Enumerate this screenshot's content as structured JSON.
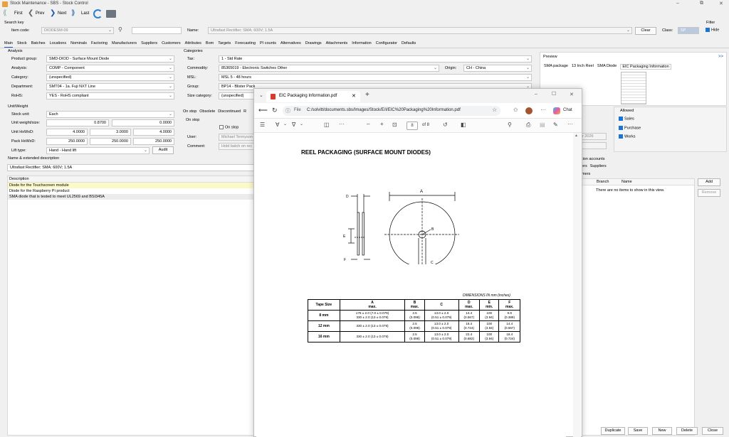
{
  "window": {
    "title": "Stock Maintenance - SBS - Stock Control",
    "min": "–",
    "restore": "⧉",
    "close": "✕"
  },
  "toolbar": {
    "first": "First",
    "prev": "Prev",
    "next": "Next",
    "last": "Last"
  },
  "search": {
    "section": "Search key",
    "item_code_label": "Item code:",
    "item_code": "DIODESM-09",
    "name_label": "Name:",
    "name": "Ultrafast Rectifier; SMA; 600V; 1.5A",
    "clear": "Clear",
    "class_label": "Class:",
    "class_value": "SP",
    "filter_label": "Filter",
    "hide": "Hide"
  },
  "tabs": [
    "Main",
    "Stock",
    "Batches",
    "Locations",
    "Nominals",
    "Factoring",
    "Manufacturers",
    "Suppliers",
    "Customers",
    "Attributes",
    "Bom",
    "Targets",
    "Forecasting",
    "PI counts",
    "Alternatives",
    "Drawings",
    "Attachments",
    "Information",
    "Configurator",
    "Defaults"
  ],
  "analysis": {
    "header": "Analysis",
    "product_group_label": "Product group:",
    "product_group": "SMD-DIOD - Surface Mount Diode",
    "analysis_label": "Analysis:",
    "analysis": "COMP - Component",
    "category_label": "Category:",
    "category": "(unspecified)",
    "department_label": "Department:",
    "department": "SMT04 - 1a. Fuji NXT Line",
    "rohs_label": "RoHS:",
    "rohs": "YES - RoHS compliant"
  },
  "categories": {
    "header": "Categories",
    "tax_label": "Tax:",
    "tax": "1 - Std Rate",
    "commodity_label": "Commodity:",
    "commodity": "85365019 - Electronic Switches Other",
    "origin_label": "Origin:",
    "origin": "CH - China",
    "msl_label": "MSL:",
    "msl": "MSL 5 - 48 hours",
    "group_label": "Group:",
    "group": "BP14 - Blister Pack",
    "size_label": "Size category:",
    "size": "(unspecified)"
  },
  "unit": {
    "header": "Unit/Weight",
    "stock_unit_label": "Stock unit:",
    "stock_unit": "Each",
    "weight_label": "Unit weight/size:",
    "weight": "0.8700",
    "size": "0.0000",
    "hwd_label": "Unit HxWxD:",
    "h": "4.0000",
    "w": "3.0000",
    "d": "4.0000",
    "pack_label": "Pack HxWxD:",
    "ph": "250.0000",
    "pw": "250.0000",
    "pd": "250.0000",
    "lift_label": "Lift type:",
    "lift": "Hand - Hand lift",
    "audit": "Audit"
  },
  "onstop": {
    "tabs": [
      "On stop",
      "Obsolete",
      "Discontinued",
      "R"
    ],
    "header": "On stop",
    "check_label": "On stop",
    "user_label": "User:",
    "user": "Michael Tennyson",
    "comment_label": "Comment:",
    "comment": "Hold batch on rec"
  },
  "name_ext": {
    "header": "Name & extended description",
    "value": "Ultrafast Rectifier; SMA; 600V; 1.5A"
  },
  "description": {
    "header": "Description",
    "rows": [
      "Diode for the Touchscreen module",
      "Diode for the Raspberry Pi product",
      "SMA diode that is tested to meet UL2569 and BSI345A"
    ]
  },
  "preview": {
    "header": "Preview",
    "expand": ">>",
    "tabs": [
      "SMA package",
      "13 Inch Reel",
      "SMA Diode",
      "EIC Packaging Information"
    ]
  },
  "allowed": {
    "header": "Allowed",
    "sales": "Sales",
    "purchase": "Purchase",
    "works": "Works",
    "date_fragment": "r 2026"
  },
  "accounts": {
    "header": "ation accounts",
    "tabs": [
      "ners",
      "Suppliers"
    ],
    "sub": "omers",
    "col_e": "e",
    "col_branch": "Branch",
    "col_name": "Name",
    "empty": "There are no items to show in this view.",
    "add": "Add",
    "remove": "Remove"
  },
  "bottom_buttons": [
    "Duplicate",
    "Save",
    "New",
    "Delete",
    "Close"
  ],
  "pdf": {
    "tab_title": "EIC Packaging Information.pdf",
    "file_label": "File",
    "url": "C:/solvitt/documents.sbs/Images/Stock/E/I/EIC%20Packaging%20Information.pdf",
    "chat": "Chat",
    "page": "8",
    "of": "of 8",
    "heading": "REEL PACKAGING (SURFACE MOUNT DIODES)",
    "dim_note": "DIMENSIONS IN mm  (inches)",
    "diagram_labels": {
      "a": "A",
      "b": "B",
      "c": "C",
      "d": "D",
      "e": "E",
      "f": "F"
    },
    "table": {
      "headers": [
        "Tape Size",
        "A\nmax.",
        "B\nmax.",
        "C",
        "D\nmax.",
        "E\nmin.",
        "F\nmax."
      ],
      "rows": [
        {
          "size": "8 mm",
          "a": [
            "178 ± 2.0 (7.0 ± 0.079)",
            "330 ± 2.0 (13 ± 0.079)"
          ],
          "b": [
            "2.5",
            "(0.098)"
          ],
          "c": [
            "13.0 ± 2.0",
            "(0.51 ± 0.079)"
          ],
          "d": [
            "14.4",
            "(0.567)"
          ],
          "e": [
            "100",
            "(3.94)"
          ],
          "f": [
            "9.9",
            "(0.389)"
          ]
        },
        {
          "size": "12 mm",
          "a": [
            "330 ± 2.0 (13 ± 0.079)"
          ],
          "b": [
            "2.5",
            "(0.098)"
          ],
          "c": [
            "13.0 ± 2.0",
            "(0.51 ± 0.079)"
          ],
          "d": [
            "18.4",
            "(0.724)"
          ],
          "e": [
            "100",
            "(3.94)"
          ],
          "f": [
            "14.4",
            "(0.567)"
          ]
        },
        {
          "size": "16 mm",
          "a": [
            "330 ± 2.0 (13 ± 0.079)"
          ],
          "b": [
            "2.5",
            "(0.098)"
          ],
          "c": [
            "13.0 ± 2.0",
            "(0.51 ± 0.079)"
          ],
          "d": [
            "22.4",
            "(0.882)"
          ],
          "e": [
            "100",
            "(3.94)"
          ],
          "f": [
            "18.4",
            "(0.724)"
          ]
        }
      ]
    }
  }
}
